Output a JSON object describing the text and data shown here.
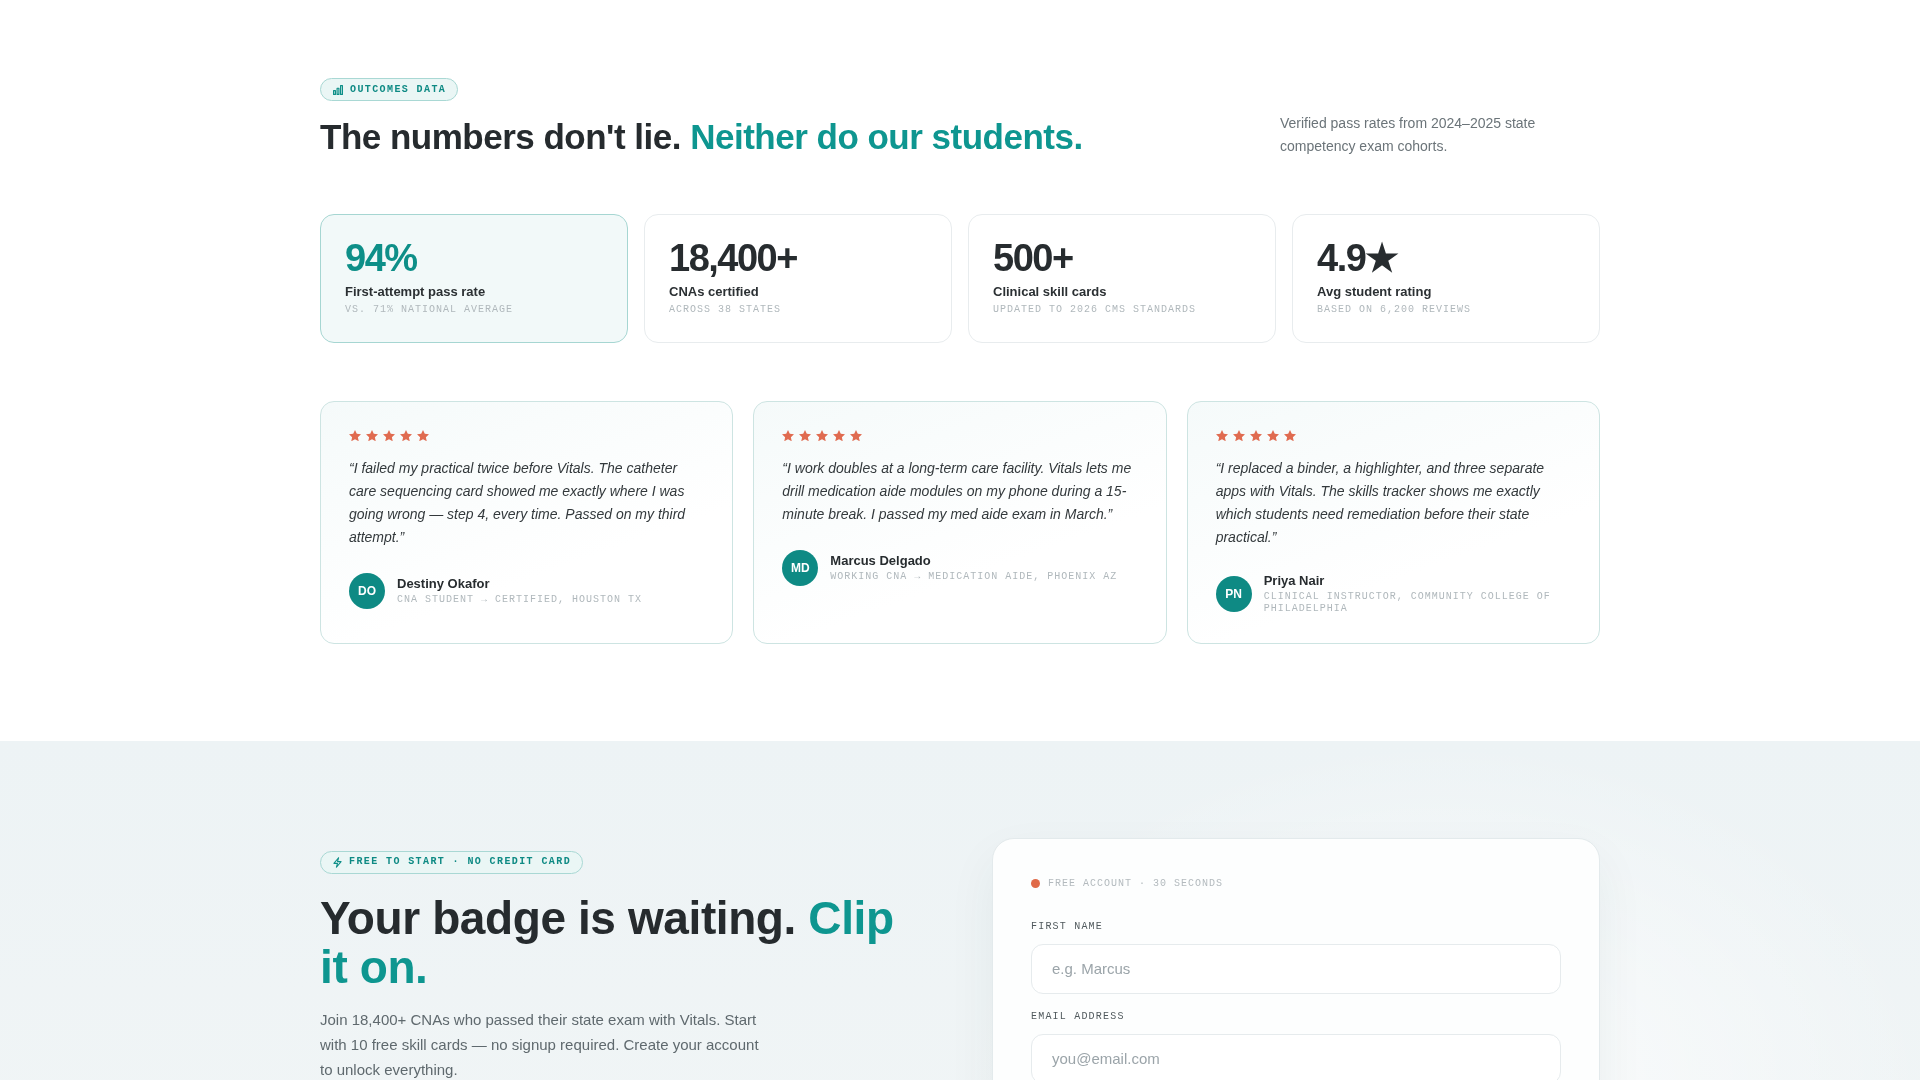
{
  "outcomes": {
    "badge": "OUTCOMES DATA",
    "heading": "The numbers don't lie.",
    "heading_accent": "Neither do our students.",
    "note": "Verified pass rates from 2024–2025 state competency exam cohorts."
  },
  "stats": [
    {
      "value": "94%",
      "label": "First-attempt pass rate",
      "detail": "VS. 71% NATIONAL AVERAGE",
      "featured": true
    },
    {
      "value": "18,400+",
      "label": "CNAs certified",
      "detail": "ACROSS 38 STATES",
      "featured": false
    },
    {
      "value": "500+",
      "label": "Clinical skill cards",
      "detail": "UPDATED TO 2026 CMS STANDARDS",
      "featured": false
    },
    {
      "value": "4.9★",
      "label": "Avg student rating",
      "detail": "BASED ON 6,200 REVIEWS",
      "featured": false
    }
  ],
  "testimonials": [
    {
      "stars": 5,
      "quote": "“I failed my practical twice before Vitals. The catheter care sequencing card showed me exactly where I was going wrong — step 4, every time. Passed on my third attempt.”",
      "initials": "DO",
      "name": "Destiny Okafor",
      "role": "CNA STUDENT → CERTIFIED, HOUSTON TX"
    },
    {
      "stars": 5,
      "quote": "“I work doubles at a long-term care facility. Vitals lets me drill medication aide modules on my phone during a 15-minute break. I passed my med aide exam in March.”",
      "initials": "MD",
      "name": "Marcus Delgado",
      "role": "WORKING CNA → MEDICATION AIDE, PHOENIX AZ"
    },
    {
      "stars": 5,
      "quote": "“I replaced a binder, a highlighter, and three separate apps with Vitals. The skills tracker shows me exactly which students need remediation before their state practical.”",
      "initials": "PN",
      "name": "Priya Nair",
      "role": "CLINICAL INSTRUCTOR, COMMUNITY COLLEGE OF PHILADELPHIA"
    }
  ],
  "signup": {
    "badge": "FREE TO START · NO CREDIT CARD",
    "heading": "Your badge is waiting.",
    "heading_accent": "Clip it on.",
    "text": "Join 18,400+ CNAs who passed their state exam with Vitals. Start with 10 free skill cards — no signup required. Create your account to unlock everything.",
    "form": {
      "status": "FREE ACCOUNT · 30 SECONDS",
      "fields": [
        {
          "label": "FIRST NAME",
          "placeholder": "e.g. Marcus"
        },
        {
          "label": "EMAIL ADDRESS",
          "placeholder": "you@email.com"
        }
      ]
    }
  }
}
